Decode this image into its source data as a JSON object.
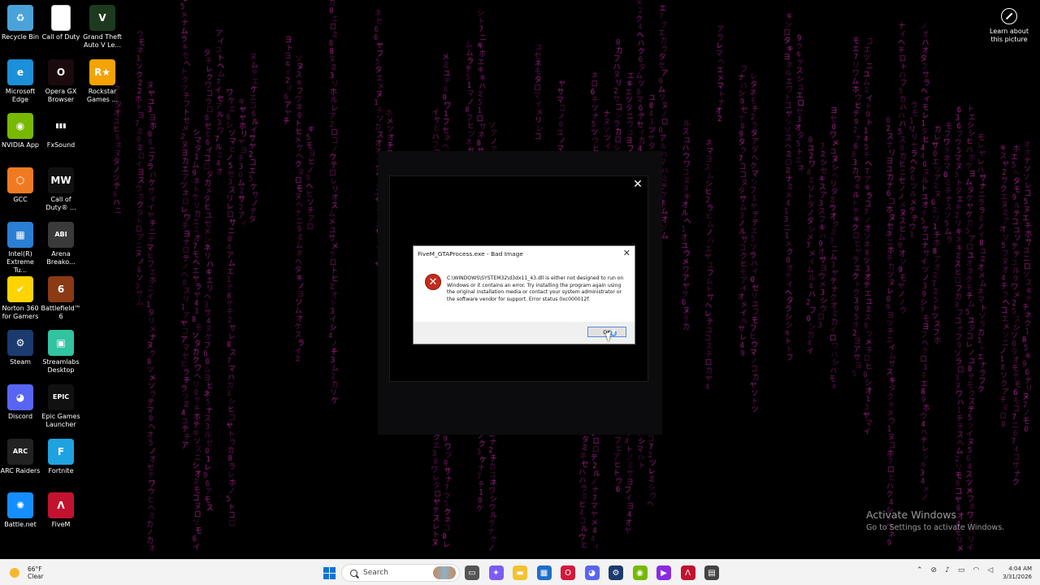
{
  "desktop": {
    "icons": [
      {
        "label": "Recycle Bin",
        "icon": "recycle-bin-icon",
        "color": "#4aa3d8",
        "glyph": "♻"
      },
      {
        "label": "Call of Duty",
        "icon": "file-icon",
        "color": "#ffffff",
        "glyph": ""
      },
      {
        "label": "Grand Theft Auto V Le...",
        "icon": "gta-v-icon",
        "color": "#1e3a1e",
        "glyph": "V"
      },
      {
        "label": "Microsoft Edge",
        "icon": "edge-icon",
        "color": "#1b8fd8",
        "glyph": "e"
      },
      {
        "label": "Opera GX Browser",
        "icon": "opera-gx-icon",
        "color": "#1a0a0e",
        "glyph": "O"
      },
      {
        "label": "Rockstar Games ...",
        "icon": "rockstar-icon",
        "color": "#f4a300",
        "glyph": "R★"
      },
      {
        "label": "NVIDIA App",
        "icon": "nvidia-icon",
        "color": "#76b900",
        "glyph": "◉"
      },
      {
        "label": "FxSound",
        "icon": "fxsound-icon",
        "color": "#000000",
        "glyph": "▮▮▮"
      },
      {
        "label": "GCC",
        "icon": "gcc-icon",
        "color": "#f07a22",
        "glyph": "⬡"
      },
      {
        "label": "Call of Duty® ...",
        "icon": "mw-icon",
        "color": "#111111",
        "glyph": "MW"
      },
      {
        "label": "Intel(R) Extreme Tu...",
        "icon": "intel-xtu-icon",
        "color": "#2a7fd4",
        "glyph": "▦"
      },
      {
        "label": "Arena Breako...",
        "icon": "arena-breakout-icon",
        "color": "#3a3a3a",
        "glyph": "ABI"
      },
      {
        "label": "Norton 360 for Gamers",
        "icon": "norton-icon",
        "color": "#ffd400",
        "glyph": "✔"
      },
      {
        "label": "Battlefield™ 6",
        "icon": "battlefield-icon",
        "color": "#8a3a14",
        "glyph": "6"
      },
      {
        "label": "Steam",
        "icon": "steam-icon",
        "color": "#1b3b6f",
        "glyph": "⚙"
      },
      {
        "label": "Streamlabs Desktop",
        "icon": "streamlabs-icon",
        "color": "#31c3a2",
        "glyph": "▣"
      },
      {
        "label": "Discord",
        "icon": "discord-icon",
        "color": "#5865f2",
        "glyph": "◕"
      },
      {
        "label": "Epic Games Launcher",
        "icon": "epic-games-icon",
        "color": "#111111",
        "glyph": "EPIC"
      },
      {
        "label": "ARC Raiders",
        "icon": "arc-raiders-icon",
        "color": "#222222",
        "glyph": "ARC"
      },
      {
        "label": "Fortnite",
        "icon": "fortnite-icon",
        "color": "#1ea3e0",
        "glyph": "F"
      },
      {
        "label": "Battle.net",
        "icon": "battlenet-icon",
        "color": "#148eff",
        "glyph": "✺"
      },
      {
        "label": "FiveM",
        "icon": "fivem-icon",
        "color": "#c1122f",
        "glyph": "Λ"
      }
    ],
    "learn_about": "Learn about this picture",
    "matrix_color": "#cc2aa8"
  },
  "launcher": {
    "close": "✕"
  },
  "dialog": {
    "title": "FiveM_GTAProcess.exe - Bad Image",
    "close": "✕",
    "message": "C:\\WINDOWS\\SYSTEM32\\d3dx11_43.dll is either not designed to run on Windows or it contains an error. Try installing the program again using the original installation media or contact your system administrator or the software vendor for support. Error status 0xc000012f.",
    "ok_label": "OK"
  },
  "watermark": {
    "title": "Activate Windows",
    "subtitle": "Go to Settings to activate Windows."
  },
  "taskbar": {
    "weather_temp": "66°F",
    "weather_cond": "Clear",
    "search_placeholder": "Search",
    "apps": [
      {
        "icon": "task-view-icon",
        "color": "#555555",
        "glyph": "▭"
      },
      {
        "icon": "copilot-icon",
        "color": "#7b5cf5",
        "glyph": "✦"
      },
      {
        "icon": "file-explorer-icon",
        "color": "#f2c230",
        "glyph": "▬"
      },
      {
        "icon": "microsoft-store-icon",
        "color": "#1f6ec9",
        "glyph": "▦"
      },
      {
        "icon": "opera-gx-taskbar-icon",
        "color": "#d11a3c",
        "glyph": "O"
      },
      {
        "icon": "discord-taskbar-icon",
        "color": "#5865f2",
        "glyph": "◕"
      },
      {
        "icon": "steam-taskbar-icon",
        "color": "#1b3b6f",
        "glyph": "⚙"
      },
      {
        "icon": "nvidia-taskbar-icon",
        "color": "#76b900",
        "glyph": "◉"
      },
      {
        "icon": "game-app-taskbar-icon",
        "color": "#8a2be2",
        "glyph": "▶"
      },
      {
        "icon": "fivem-taskbar-icon",
        "color": "#c1122f",
        "glyph": "Λ"
      },
      {
        "icon": "window-taskbar-icon",
        "color": "#444444",
        "glyph": "▤"
      }
    ],
    "time": "4:04 AM",
    "date": "3/31/2026"
  }
}
